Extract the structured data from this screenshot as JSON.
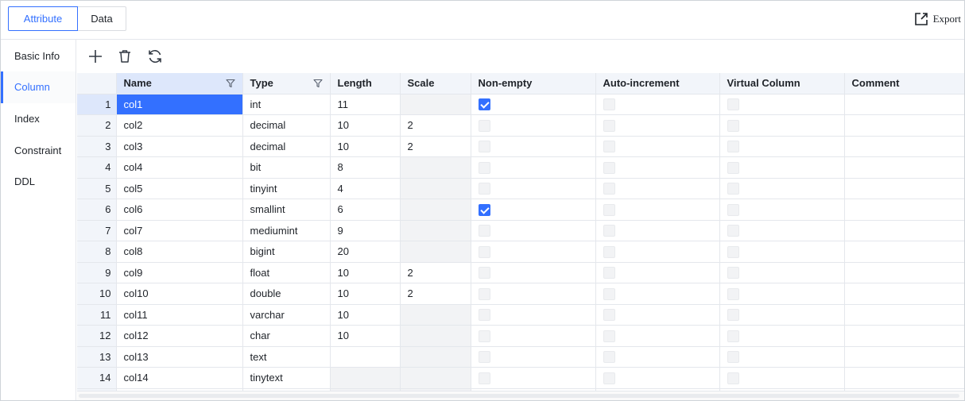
{
  "tabs": [
    {
      "label": "Attribute",
      "active": true
    },
    {
      "label": "Data",
      "active": false
    }
  ],
  "export": {
    "label": "Export",
    "icon": "export-icon"
  },
  "sidebar": {
    "items": [
      {
        "label": "Basic Info",
        "active": false
      },
      {
        "label": "Column",
        "active": true
      },
      {
        "label": "Index",
        "active": false
      },
      {
        "label": "Constraint",
        "active": false
      },
      {
        "label": "DDL",
        "active": false
      }
    ]
  },
  "toolbar": {
    "icons": [
      "plus-icon",
      "trash-icon",
      "refresh-icon"
    ]
  },
  "colors": {
    "accent": "#3370ff",
    "header_bg": "#f2f5fa",
    "selected_header_bg": "#dde7fb",
    "disabled_cell": "#f2f3f5"
  },
  "table": {
    "columns": [
      {
        "label": "Name",
        "filter": true
      },
      {
        "label": "Type",
        "filter": true
      },
      {
        "label": "Length",
        "filter": false
      },
      {
        "label": "Scale",
        "filter": false
      },
      {
        "label": "Non-empty",
        "filter": false
      },
      {
        "label": "Auto-increment",
        "filter": false
      },
      {
        "label": "Virtual Column",
        "filter": false
      },
      {
        "label": "Comment",
        "filter": false
      }
    ],
    "rows": [
      {
        "num": "1",
        "name": "col1",
        "type": "int",
        "length": "11",
        "scale": "",
        "scale_disabled": true,
        "length_disabled": false,
        "nonempty": true
      },
      {
        "num": "2",
        "name": "col2",
        "type": "decimal",
        "length": "10",
        "scale": "2",
        "scale_disabled": false,
        "length_disabled": false,
        "nonempty": false
      },
      {
        "num": "3",
        "name": "col3",
        "type": "decimal",
        "length": "10",
        "scale": "2",
        "scale_disabled": false,
        "length_disabled": false,
        "nonempty": false
      },
      {
        "num": "4",
        "name": "col4",
        "type": "bit",
        "length": "8",
        "scale": "",
        "scale_disabled": true,
        "length_disabled": false,
        "nonempty": false
      },
      {
        "num": "5",
        "name": "col5",
        "type": "tinyint",
        "length": "4",
        "scale": "",
        "scale_disabled": true,
        "length_disabled": false,
        "nonempty": false
      },
      {
        "num": "6",
        "name": "col6",
        "type": "smallint",
        "length": "6",
        "scale": "",
        "scale_disabled": true,
        "length_disabled": false,
        "nonempty": true
      },
      {
        "num": "7",
        "name": "col7",
        "type": "mediumint",
        "length": "9",
        "scale": "",
        "scale_disabled": true,
        "length_disabled": false,
        "nonempty": false
      },
      {
        "num": "8",
        "name": "col8",
        "type": "bigint",
        "length": "20",
        "scale": "",
        "scale_disabled": true,
        "length_disabled": false,
        "nonempty": false
      },
      {
        "num": "9",
        "name": "col9",
        "type": "float",
        "length": "10",
        "scale": "2",
        "scale_disabled": false,
        "length_disabled": false,
        "nonempty": false
      },
      {
        "num": "10",
        "name": "col10",
        "type": "double",
        "length": "10",
        "scale": "2",
        "scale_disabled": false,
        "length_disabled": false,
        "nonempty": false
      },
      {
        "num": "11",
        "name": "col11",
        "type": "varchar",
        "length": "10",
        "scale": "",
        "scale_disabled": true,
        "length_disabled": false,
        "nonempty": false
      },
      {
        "num": "12",
        "name": "col12",
        "type": "char",
        "length": "10",
        "scale": "",
        "scale_disabled": true,
        "length_disabled": false,
        "nonempty": false
      },
      {
        "num": "13",
        "name": "col13",
        "type": "text",
        "length": "",
        "scale": "",
        "scale_disabled": true,
        "length_disabled": false,
        "nonempty": false
      },
      {
        "num": "14",
        "name": "col14",
        "type": "tinytext",
        "length": "",
        "scale": "",
        "scale_disabled": true,
        "length_disabled": true,
        "nonempty": false
      },
      {
        "num": "",
        "name": "",
        "type": "",
        "length": "",
        "scale": "",
        "scale_disabled": true,
        "length_disabled": true,
        "nonempty": false
      }
    ]
  }
}
